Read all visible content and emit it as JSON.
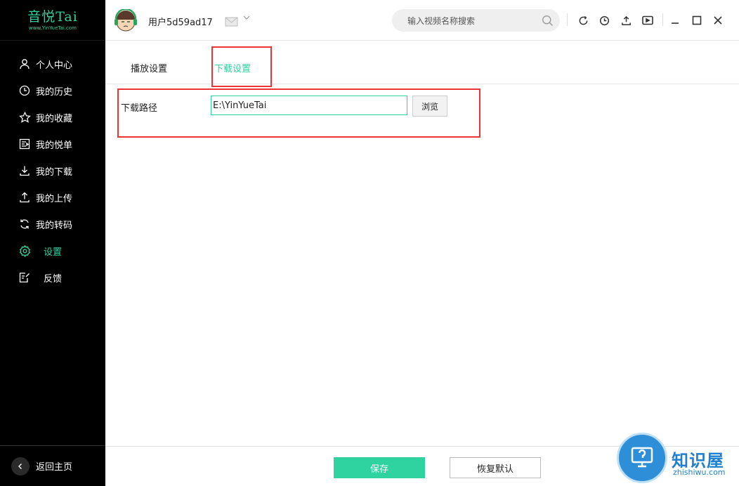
{
  "app": {
    "logo_main": "音悦Tai",
    "logo_sub": "www.YinYueTai.com"
  },
  "sidebar": {
    "items": [
      {
        "label": "个人中心",
        "icon": "user-icon"
      },
      {
        "label": "我的历史",
        "icon": "clock-icon"
      },
      {
        "label": "我的收藏",
        "icon": "star-icon"
      },
      {
        "label": "我的悦单",
        "icon": "playlist-icon"
      },
      {
        "label": "我的下载",
        "icon": "download-icon"
      },
      {
        "label": "我的上传",
        "icon": "upload-icon"
      },
      {
        "label": "我的转码",
        "icon": "convert-icon"
      },
      {
        "label": "设置",
        "icon": "gear-icon",
        "active": true
      },
      {
        "label": "反馈",
        "icon": "feedback-icon"
      }
    ],
    "back_label": "返回主页"
  },
  "header": {
    "username": "用户5d59ad17",
    "search_placeholder": "输入视频名称搜索"
  },
  "tabs": [
    {
      "label": "播放设置"
    },
    {
      "label": "下载设置",
      "active": true
    }
  ],
  "download": {
    "path_label": "下载路径",
    "path_value": "E:\\YinYueTai",
    "browse_label": "浏览"
  },
  "footer": {
    "save_label": "保存",
    "reset_label": "恢复默认"
  },
  "watermark": {
    "title": "知识屋",
    "sub": "zhishiwu.com"
  },
  "colors": {
    "accent": "#2ed3a0",
    "highlight_box": "#ee3333",
    "sidebar_bg": "#000000"
  }
}
